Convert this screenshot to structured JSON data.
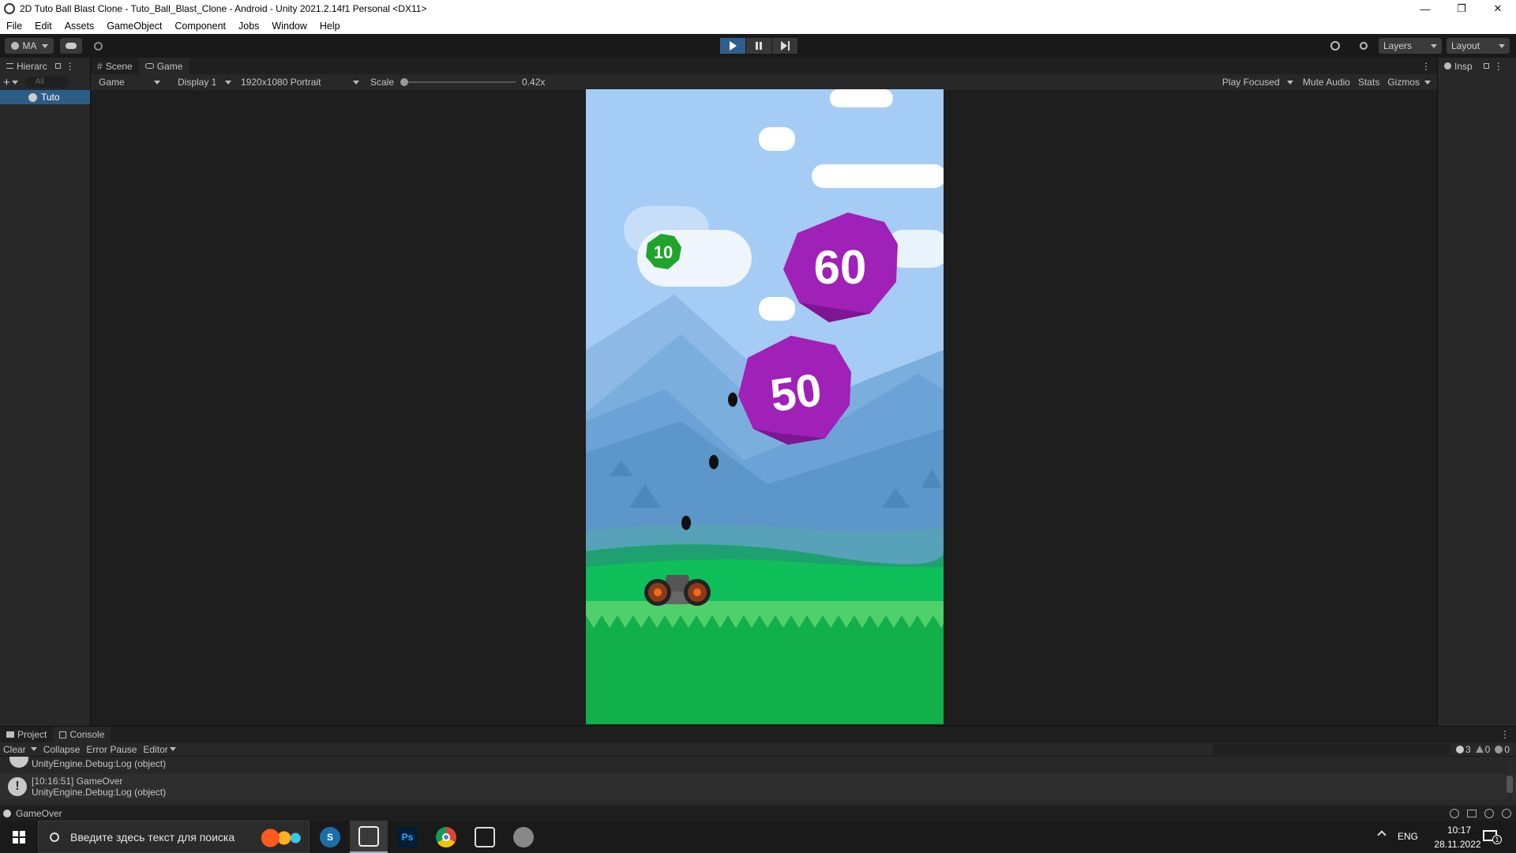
{
  "window": {
    "title": "2D Tuto Ball Blast Clone - Tuto_Ball_Blast_Clone - Android - Unity 2021.2.14f1 Personal <DX11>",
    "minimize": "—",
    "maximize": "❐",
    "close": "✕"
  },
  "menu": [
    "File",
    "Edit",
    "Assets",
    "GameObject",
    "Component",
    "Jobs",
    "Window",
    "Help"
  ],
  "toolbar": {
    "account": "MA",
    "layers": "Layers",
    "layout": "Layout"
  },
  "hierarchy": {
    "tab": "Hierarc",
    "search_placeholder": "All",
    "root_item": "Tuto"
  },
  "tabs": {
    "scene": "Scene",
    "game": "Game"
  },
  "game_toolbar": {
    "mode": "Game",
    "display": "Display 1",
    "resolution": "1920x1080 Portrait",
    "scale_label": "Scale",
    "scale_value": "0.42x",
    "scale_fraction": 0.0,
    "play_focused": "Play Focused",
    "mute_audio": "Mute Audio",
    "stats": "Stats",
    "gizmos": "Gizmos"
  },
  "inspector": {
    "tab": "Insp"
  },
  "game": {
    "balls": [
      {
        "value": "10",
        "color": "#1fa42c"
      },
      {
        "value": "60",
        "color": "#a021b7"
      },
      {
        "value": "50",
        "color": "#a021b7"
      }
    ],
    "sky_color": "#a5ccf5",
    "grass_color": "#11b04a"
  },
  "console": {
    "tab_project": "Project",
    "tab_console": "Console",
    "clear": "Clear",
    "collapse": "Collapse",
    "error_pause": "Error Pause",
    "editor": "Editor",
    "count_info": "3",
    "count_warn": "0",
    "count_error": "0",
    "entries": [
      {
        "line1": "",
        "line2": "UnityEngine.Debug:Log (object)"
      },
      {
        "line1": "[10:16:51] GameOver",
        "line2": "UnityEngine.Debug:Log (object)"
      }
    ]
  },
  "status": {
    "text": "GameOver"
  },
  "taskbar": {
    "search_placeholder": "Введите здесь текст для поиска",
    "lang": "ENG",
    "time": "10:17",
    "date": "28.11.2022",
    "notification_count": "1"
  }
}
